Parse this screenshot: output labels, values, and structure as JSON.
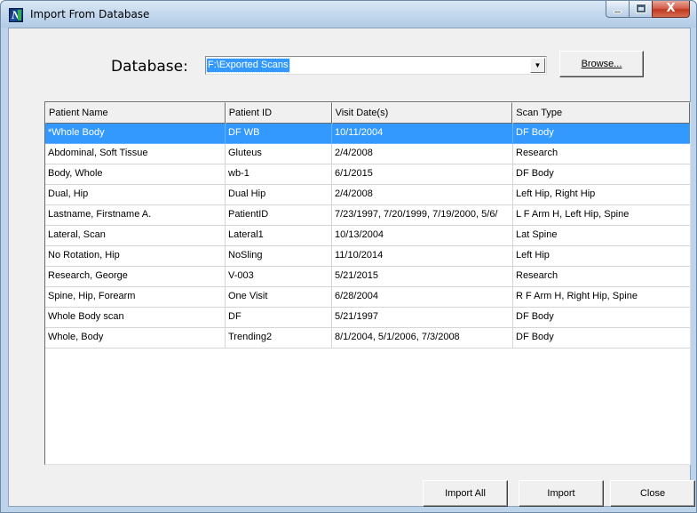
{
  "window": {
    "title": "Import From Database",
    "caption_close": "X"
  },
  "database": {
    "label": "Database:",
    "value": "F:\\Exported Scans",
    "dropdown_arrow": "▼",
    "browse_label": "Browse..."
  },
  "table": {
    "columns": [
      "Patient Name",
      "Patient ID",
      "Visit Date(s)",
      "Scan Type"
    ],
    "selected_row": 0,
    "rows": [
      [
        "*Whole Body",
        "DF WB",
        "10/11/2004",
        "DF Body"
      ],
      [
        "Abdominal, Soft Tissue",
        "Gluteus",
        "2/4/2008",
        "Research"
      ],
      [
        "Body, Whole",
        "wb-1",
        "6/1/2015",
        "DF Body"
      ],
      [
        "Dual, Hip",
        "Dual Hip",
        "2/4/2008",
        "Left Hip, Right Hip"
      ],
      [
        "Lastname, Firstname A.",
        "PatientID",
        "7/23/1997, 7/20/1999, 7/19/2000, 5/6/",
        "L F Arm H, Left Hip, Spine"
      ],
      [
        "Lateral, Scan",
        "Lateral1",
        "10/13/2004",
        "Lat Spine"
      ],
      [
        "No Rotation, Hip",
        "NoSling",
        "11/10/2014",
        "Left Hip"
      ],
      [
        "Research, George",
        "V-003",
        "5/21/2015",
        "Research"
      ],
      [
        "Spine, Hip, Forearm",
        "One Visit",
        "6/28/2004",
        "R F Arm H, Right Hip, Spine"
      ],
      [
        "Whole Body scan",
        "DF",
        "5/21/1997",
        "DF Body"
      ],
      [
        "Whole, Body",
        "Trending2",
        "8/1/2004, 5/1/2006, 7/3/2008",
        "DF Body"
      ]
    ]
  },
  "buttons": {
    "import_all": "Import All",
    "import": "Import",
    "close": "Close"
  }
}
